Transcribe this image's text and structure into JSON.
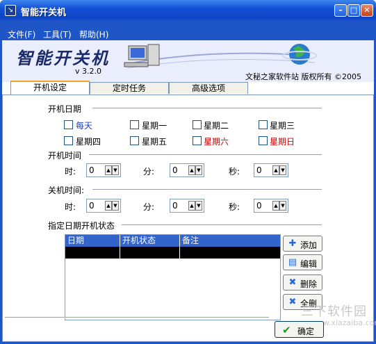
{
  "window": {
    "title": "智能开关机"
  },
  "menu": {
    "items": [
      "文件(F)",
      "工具(T)",
      "帮助(H)"
    ]
  },
  "banner": {
    "logo_text": "智能开关机",
    "version": "v 3.2.0",
    "copyright": "文秘之家软件站  版权所有  ©2005"
  },
  "tabs": [
    "开机设定",
    "定时任务",
    "高级选项"
  ],
  "boot_date": {
    "title": "开机日期",
    "days": [
      "每天",
      "星期一",
      "星期二",
      "星期三",
      "星期四",
      "星期五",
      "星期六",
      "星期日"
    ]
  },
  "boot_time": {
    "title": "开机时间",
    "hour_label": "时:",
    "minute_label": "分:",
    "second_label": "秒:",
    "hour": "0",
    "minute": "0",
    "second": "0"
  },
  "shutdown_time": {
    "title": "关机时间:",
    "hour_label": "时:",
    "minute_label": "分:",
    "second_label": "秒:",
    "hour": "0",
    "minute": "0",
    "second": "0"
  },
  "schedule": {
    "title": "指定日期开机状态",
    "columns": [
      "日期",
      "开机状态",
      "备注"
    ]
  },
  "buttons": {
    "add": "添加",
    "edit": "编辑",
    "delete": "删除",
    "delete_all": "全删",
    "ok": "确定"
  },
  "watermark": {
    "text": "三下软件园",
    "url": "www.xiazaiba.com"
  },
  "colors": {
    "titlebar": "#1450d6",
    "weekday_blue": "#1f3fd0",
    "weekend_red": "#d00000",
    "grid_header": "#3264cc"
  }
}
